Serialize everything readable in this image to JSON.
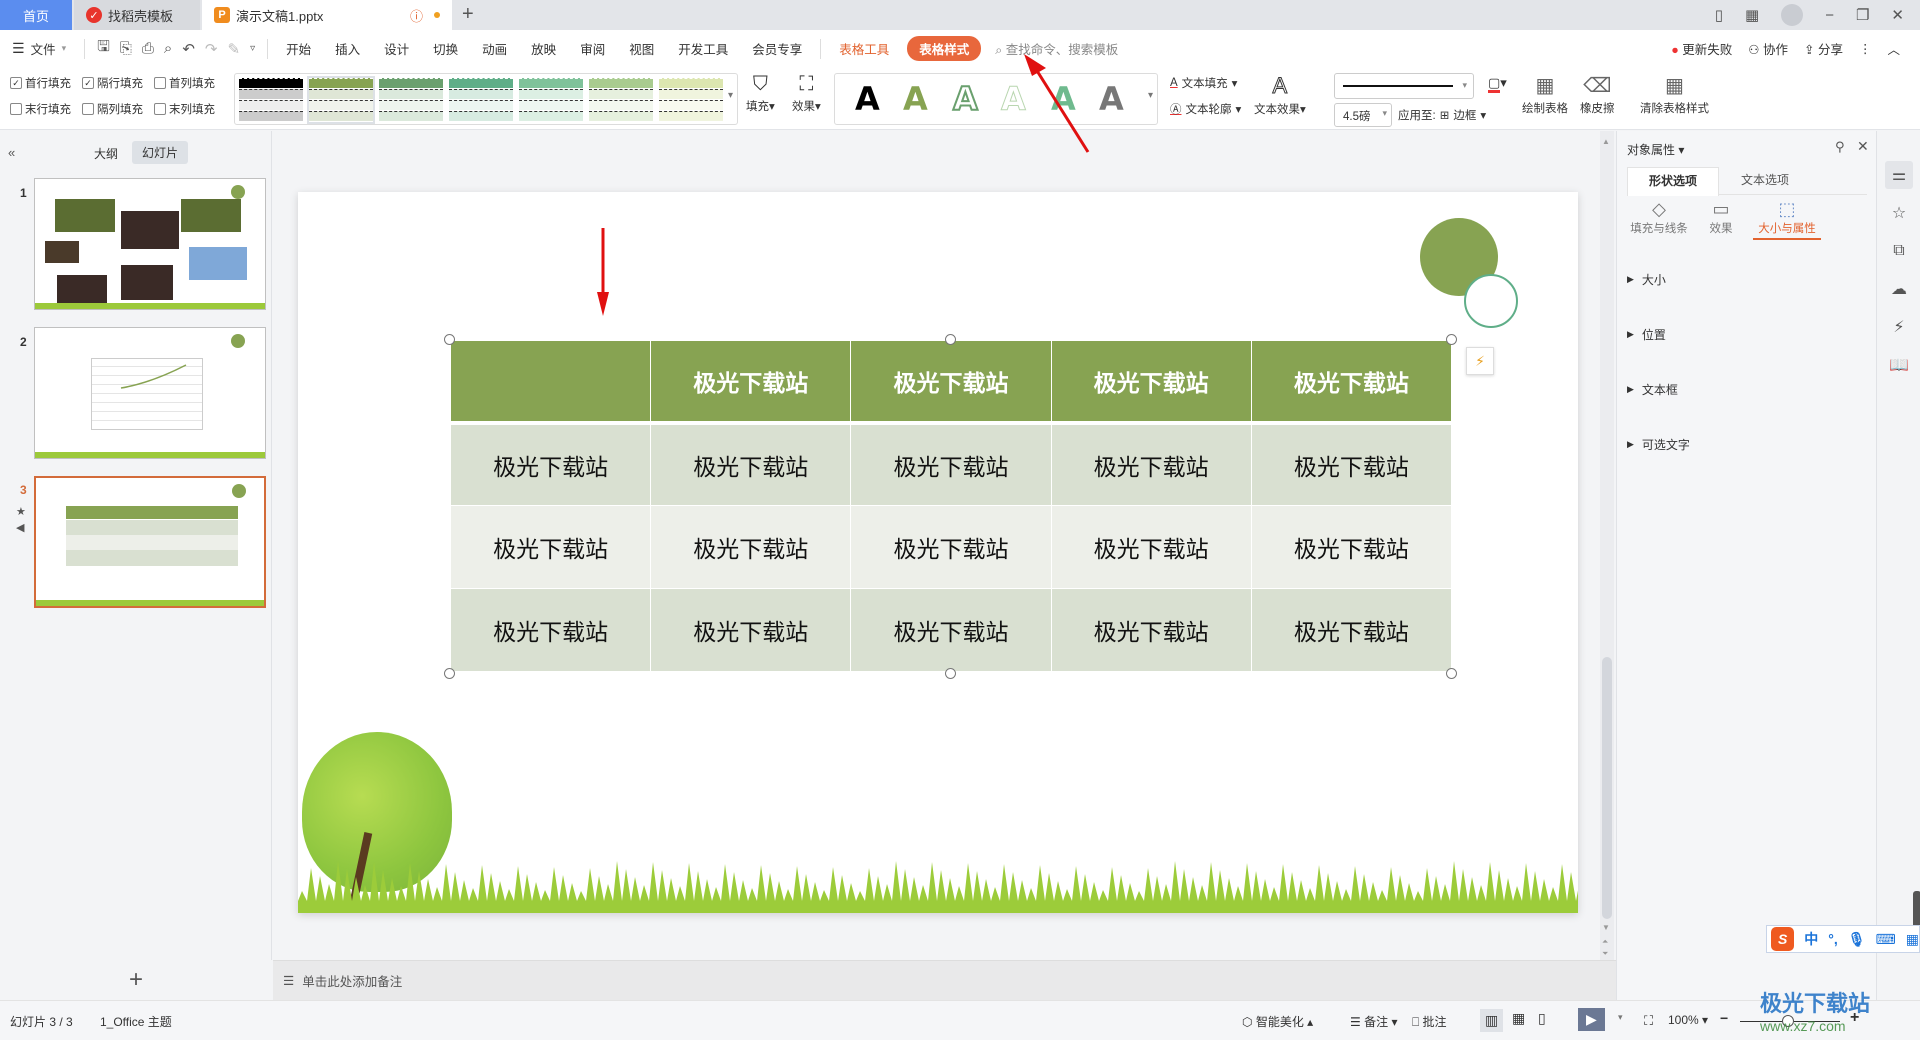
{
  "tabs": {
    "home": "首页",
    "template": "找稻壳模板",
    "document": "演示文稿1.pptx"
  },
  "menu": {
    "file": "文件",
    "items": [
      "开始",
      "插入",
      "设计",
      "切换",
      "动画",
      "放映",
      "审阅",
      "视图",
      "开发工具",
      "会员专享"
    ],
    "table_tools": "表格工具",
    "table_style": "表格样式",
    "search_placeholder": "查找命令、搜索模板",
    "update_failed": "更新失败",
    "collaborate": "协作",
    "share": "分享"
  },
  "ribbon": {
    "checkboxes": [
      {
        "label": "首行填充",
        "checked": true
      },
      {
        "label": "隔行填充",
        "checked": true
      },
      {
        "label": "首列填充",
        "checked": false
      },
      {
        "label": "末行填充",
        "checked": false
      },
      {
        "label": "隔列填充",
        "checked": false
      },
      {
        "label": "末列填充",
        "checked": false
      }
    ],
    "style_swatches": [
      "#000000",
      "#87a352",
      "#6aa06e",
      "#5fae88",
      "#7fc29a",
      "#a9cc8f",
      "#dce6b0"
    ],
    "fill": "填充",
    "effect": "效果",
    "wordart_colors": [
      "#000000",
      "#87a352",
      "#6aa06e",
      "#b9d6b0",
      "#6fba8e",
      "#777777"
    ],
    "text_fill": "文本填充",
    "text_outline": "文本轮廓",
    "text_effect": "文本效果",
    "line_weight": "4.5磅",
    "apply_to": "应用至:",
    "border": "边框",
    "draw_table": "绘制表格",
    "eraser": "橡皮擦",
    "clear_style": "清除表格样式"
  },
  "left_panel": {
    "outline_tab": "大纲",
    "slides_tab": "幻灯片",
    "slide_numbers": [
      "1",
      "2",
      "3"
    ],
    "selected": 3
  },
  "table": {
    "header": [
      "",
      "极光下载站",
      "极光下载站",
      "极光下载站",
      "极光下载站"
    ],
    "rows": [
      [
        "极光下载站",
        "极光下载站",
        "极光下载站",
        "极光下载站",
        "极光下载站"
      ],
      [
        "极光下载站",
        "极光下载站",
        "极光下载站",
        "极光下载站",
        "极光下载站"
      ],
      [
        "极光下载站",
        "极光下载站",
        "极光下载站",
        "极光下载站",
        "极光下载站"
      ]
    ],
    "colors": {
      "header": "#87a352",
      "band1": "#d9e0d1",
      "band2": "#edefe9"
    }
  },
  "right_panel": {
    "title": "对象属性",
    "tab_shape": "形状选项",
    "tab_text": "文本选项",
    "sub_fill": "填充与线条",
    "sub_effect": "效果",
    "sub_size": "大小与属性",
    "sections": [
      "大小",
      "位置",
      "文本框",
      "可选文字"
    ],
    "accent": "#e2632f"
  },
  "notes": {
    "placeholder": "单击此处添加备注"
  },
  "status": {
    "slide": "幻灯片 3 / 3",
    "theme": "1_Office 主题",
    "beautify": "智能美化",
    "notes": "备注",
    "comment": "批注",
    "zoom": "100%"
  },
  "ime": {
    "mode": "中"
  },
  "watermark": {
    "name": "极光下载站",
    "url": "www.xz7.com"
  }
}
